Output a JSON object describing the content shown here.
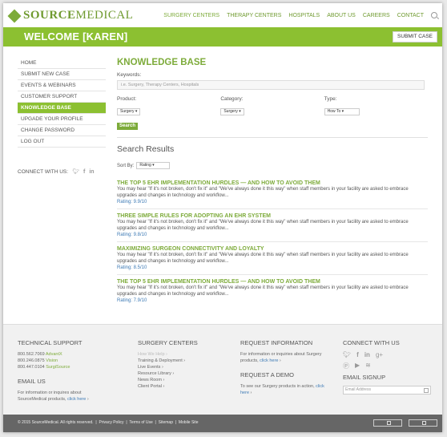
{
  "brand": {
    "name_part1": "SOURCE",
    "name_part2": "MEDICAL"
  },
  "nav": {
    "items": [
      "SURGERY CENTERS",
      "THERAPY CENTERS",
      "HOSPITALS",
      "ABOUT US",
      "CAREERS",
      "CONTACT"
    ],
    "search_icon": "search-icon"
  },
  "welcome": {
    "title": "WELCOME [KAREN]",
    "submit_label": "SUBMIT CASE"
  },
  "sidebar": {
    "items": [
      {
        "label": "HOME",
        "active": false
      },
      {
        "label": "SUBMIT NEW CASE",
        "active": false
      },
      {
        "label": "EVENTS & WEBINARS",
        "active": false
      },
      {
        "label": "CUSTOMER SUPPORT",
        "active": false
      },
      {
        "label": "KNOWLEDGE BASE",
        "active": true
      },
      {
        "label": "UPGADE YOUR PROFILE",
        "active": false
      },
      {
        "label": "CHANGE PASSWORD",
        "active": false
      },
      {
        "label": "LOG OUT",
        "active": false
      }
    ],
    "connect_label": "CONNECT WITH US:"
  },
  "main": {
    "title": "KNOWLEDGE BASE",
    "keywords_label": "Keywords:",
    "keywords_placeholder": "i.e. Surgery, Therapy Centers, Hospitals",
    "product_label": "Product:",
    "product_value": "Surgery",
    "category_label": "Category:",
    "category_value": "Surgery",
    "type_label": "Type:",
    "type_value": "How To",
    "search_button": "Search",
    "results_title": "Search Results",
    "sort_label": "Sort By:",
    "sort_value": "Rating",
    "results": [
      {
        "title": "THE TOP 5 EHR IMPLEMENTATION HURDLES — AND HOW TO AVOID THEM",
        "text": "You may hear \"If it's not broken, don't fix it\" and \"We've always done it this way\" when staff members in your facility are asked to embrace upgrades and changes in technology and workflow...",
        "rating": "Rating: 9.9/10"
      },
      {
        "title": "THREE SIMPLE RULES FOR ADOPTING AN EHR SYSTEM",
        "text": "You may hear \"If it's not broken, don't fix it\" and \"We've always done it this way\" when staff members in your facility are asked to embrace upgrades and changes in technology and workflow...",
        "rating": "Rating: 9.8/10"
      },
      {
        "title": "MAXIMIZING SURGEON CONNECTIVITY AND LOYALTY",
        "text": "You may hear \"If it's not broken, don't fix it\" and \"We've always done it this way\" when staff members in your facility are asked to embrace upgrades and changes in technology and workflow...",
        "rating": "Rating: 8.5/10"
      },
      {
        "title": "THE TOP 5 EHR IMPLEMENTATION HURDLES — AND HOW TO AVOID THEM",
        "text": "You may hear \"If it's not broken, don't fix it\" and \"We've always done it this way\" when staff members in your facility are asked to embrace upgrades and changes in technology and workflow...",
        "rating": "Rating: 7.9/10"
      }
    ]
  },
  "footer": {
    "tech_support": {
      "title": "TECHNICAL SUPPORT",
      "lines": [
        {
          "number": "800.562.7069",
          "product": "AdvantX"
        },
        {
          "number": "800.246.0875",
          "product": "Vision"
        },
        {
          "number": "800.447.0104",
          "product": "SurgiSource"
        }
      ]
    },
    "email_us": {
      "title": "EMAIL US",
      "text": "For information or inquires about SourceMedical products,",
      "link": "click here"
    },
    "surgery_centers": {
      "title": "SURGERY CENTERS",
      "items": [
        "How We Help",
        "Training & Deployment",
        "Live Events",
        "Resource Library",
        "News Room",
        "Client Portal"
      ]
    },
    "request_info": {
      "title": "REQUEST INFORMATION",
      "text": "For information or inquiries about Surgery products,",
      "link": "click here"
    },
    "request_demo": {
      "title": "REQUEST A DEMO",
      "text": "To see our Surgery products in action,",
      "link": "click here"
    },
    "connect": {
      "title": "CONNECT WITH US"
    },
    "signup": {
      "title": "EMAIL SIGNUP",
      "placeholder": "Email Address"
    }
  },
  "bottom": {
    "copyright": "© 2015 SourceMedical. All rights reserved.",
    "links": [
      "Privacy Policy",
      "Terms of Use",
      "Sitemap",
      "Mobile Site"
    ]
  },
  "colors": {
    "accent": "#8cc031",
    "accent_text": "#7dab3a",
    "link": "#3d7ab5",
    "footer_bar": "#666666"
  }
}
